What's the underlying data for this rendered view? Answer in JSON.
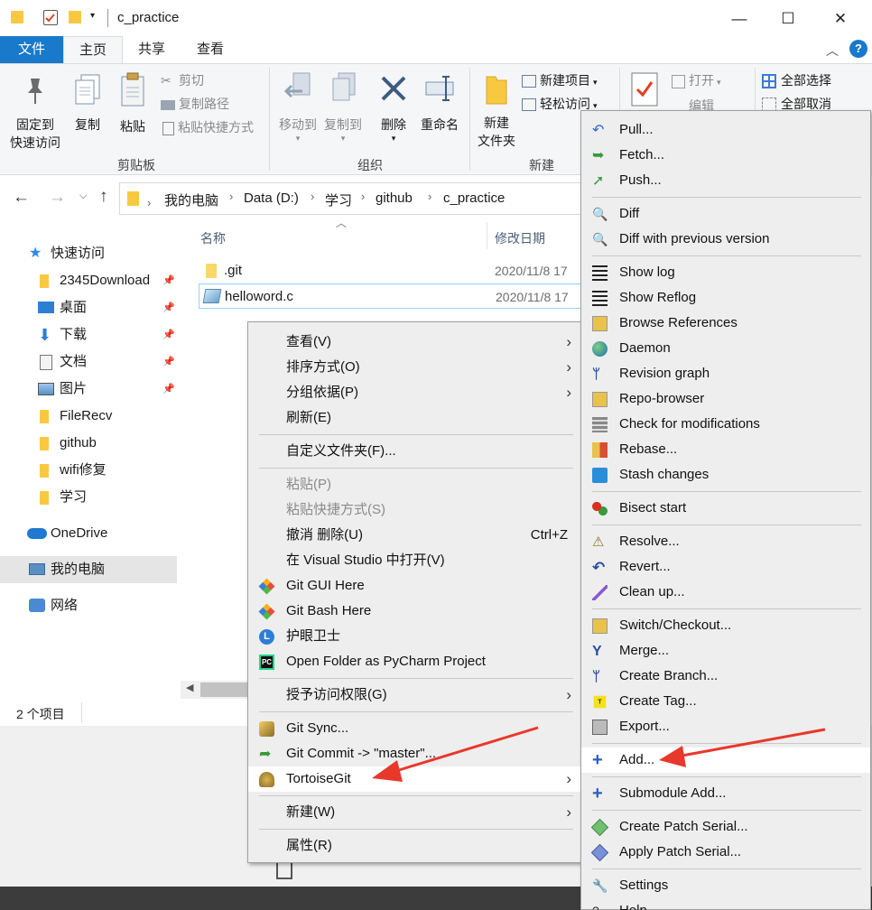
{
  "window": {
    "title": "c_practice",
    "min": "—",
    "max": "☐",
    "close": "✕"
  },
  "tabs": [
    "文件",
    "主页",
    "共享",
    "查看"
  ],
  "ribbon": {
    "pin": "固定到\n快速访问",
    "pin1": "固定到",
    "pin2": "快速访问",
    "copy": "复制",
    "paste": "粘贴",
    "cut": "剪切",
    "copy_path": "复制路径",
    "paste_shortcut": "粘贴快捷方式",
    "group_clipboard": "剪贴板",
    "move_to": "移动到",
    "copy_to": "复制到",
    "delete": "删除",
    "rename": "重命名",
    "group_organize": "组织",
    "new_item": "新建项目",
    "easy_access": "轻松访问",
    "new_folder1": "新建",
    "new_folder2": "文件夹",
    "group_new": "新建",
    "open": "打开",
    "edit": "编辑",
    "select_all": "全部选择",
    "select_none": "全部取消"
  },
  "breadcrumb": [
    "我的电脑",
    "Data (D:)",
    "学习",
    "github",
    "c_practice"
  ],
  "nav": {
    "quick_access": "快速访问",
    "items": [
      "2345Download",
      "桌面",
      "下载",
      "文档",
      "图片",
      "FileRecv",
      "github",
      "wifi修复",
      "学习"
    ],
    "onedrive": "OneDrive",
    "this_pc": "我的电脑",
    "network": "网络"
  },
  "files": {
    "col_name": "名称",
    "col_date": "修改日期",
    "rows": [
      {
        "name": ".git",
        "date": "2020/11/8 17"
      },
      {
        "name": "helloword.c",
        "date": "2020/11/8 17"
      }
    ]
  },
  "status": "2 个项目",
  "context_menu": {
    "items": [
      "查看(V)",
      "排序方式(O)",
      "分组依据(P)",
      "刷新(E)",
      "自定义文件夹(F)...",
      "粘贴(P)",
      "粘贴快捷方式(S)",
      "撤消 删除(U)",
      "在 Visual Studio 中打开(V)",
      "Git GUI Here",
      "Git Bash Here",
      "护眼卫士",
      "Open Folder as PyCharm Project",
      "授予访问权限(G)",
      "Git Sync...",
      "Git Commit -> \"master\"...",
      "TortoiseGit",
      "新建(W)",
      "属性(R)"
    ],
    "undo_shortcut": "Ctrl+Z"
  },
  "submenu": {
    "items": [
      "Pull...",
      "Fetch...",
      "Push...",
      "Diff",
      "Diff with previous version",
      "Show log",
      "Show Reflog",
      "Browse References",
      "Daemon",
      "Revision graph",
      "Repo-browser",
      "Check for modifications",
      "Rebase...",
      "Stash changes",
      "Bisect start",
      "Resolve...",
      "Revert...",
      "Clean up...",
      "Switch/Checkout...",
      "Merge...",
      "Create Branch...",
      "Create Tag...",
      "Export...",
      "Add...",
      "Submodule Add...",
      "Create Patch Serial...",
      "Apply Patch Serial...",
      "Settings",
      "Help"
    ]
  },
  "colors": {
    "accent": "#1979ca",
    "arrow": "#e8382b",
    "folder": "#f8c940"
  }
}
